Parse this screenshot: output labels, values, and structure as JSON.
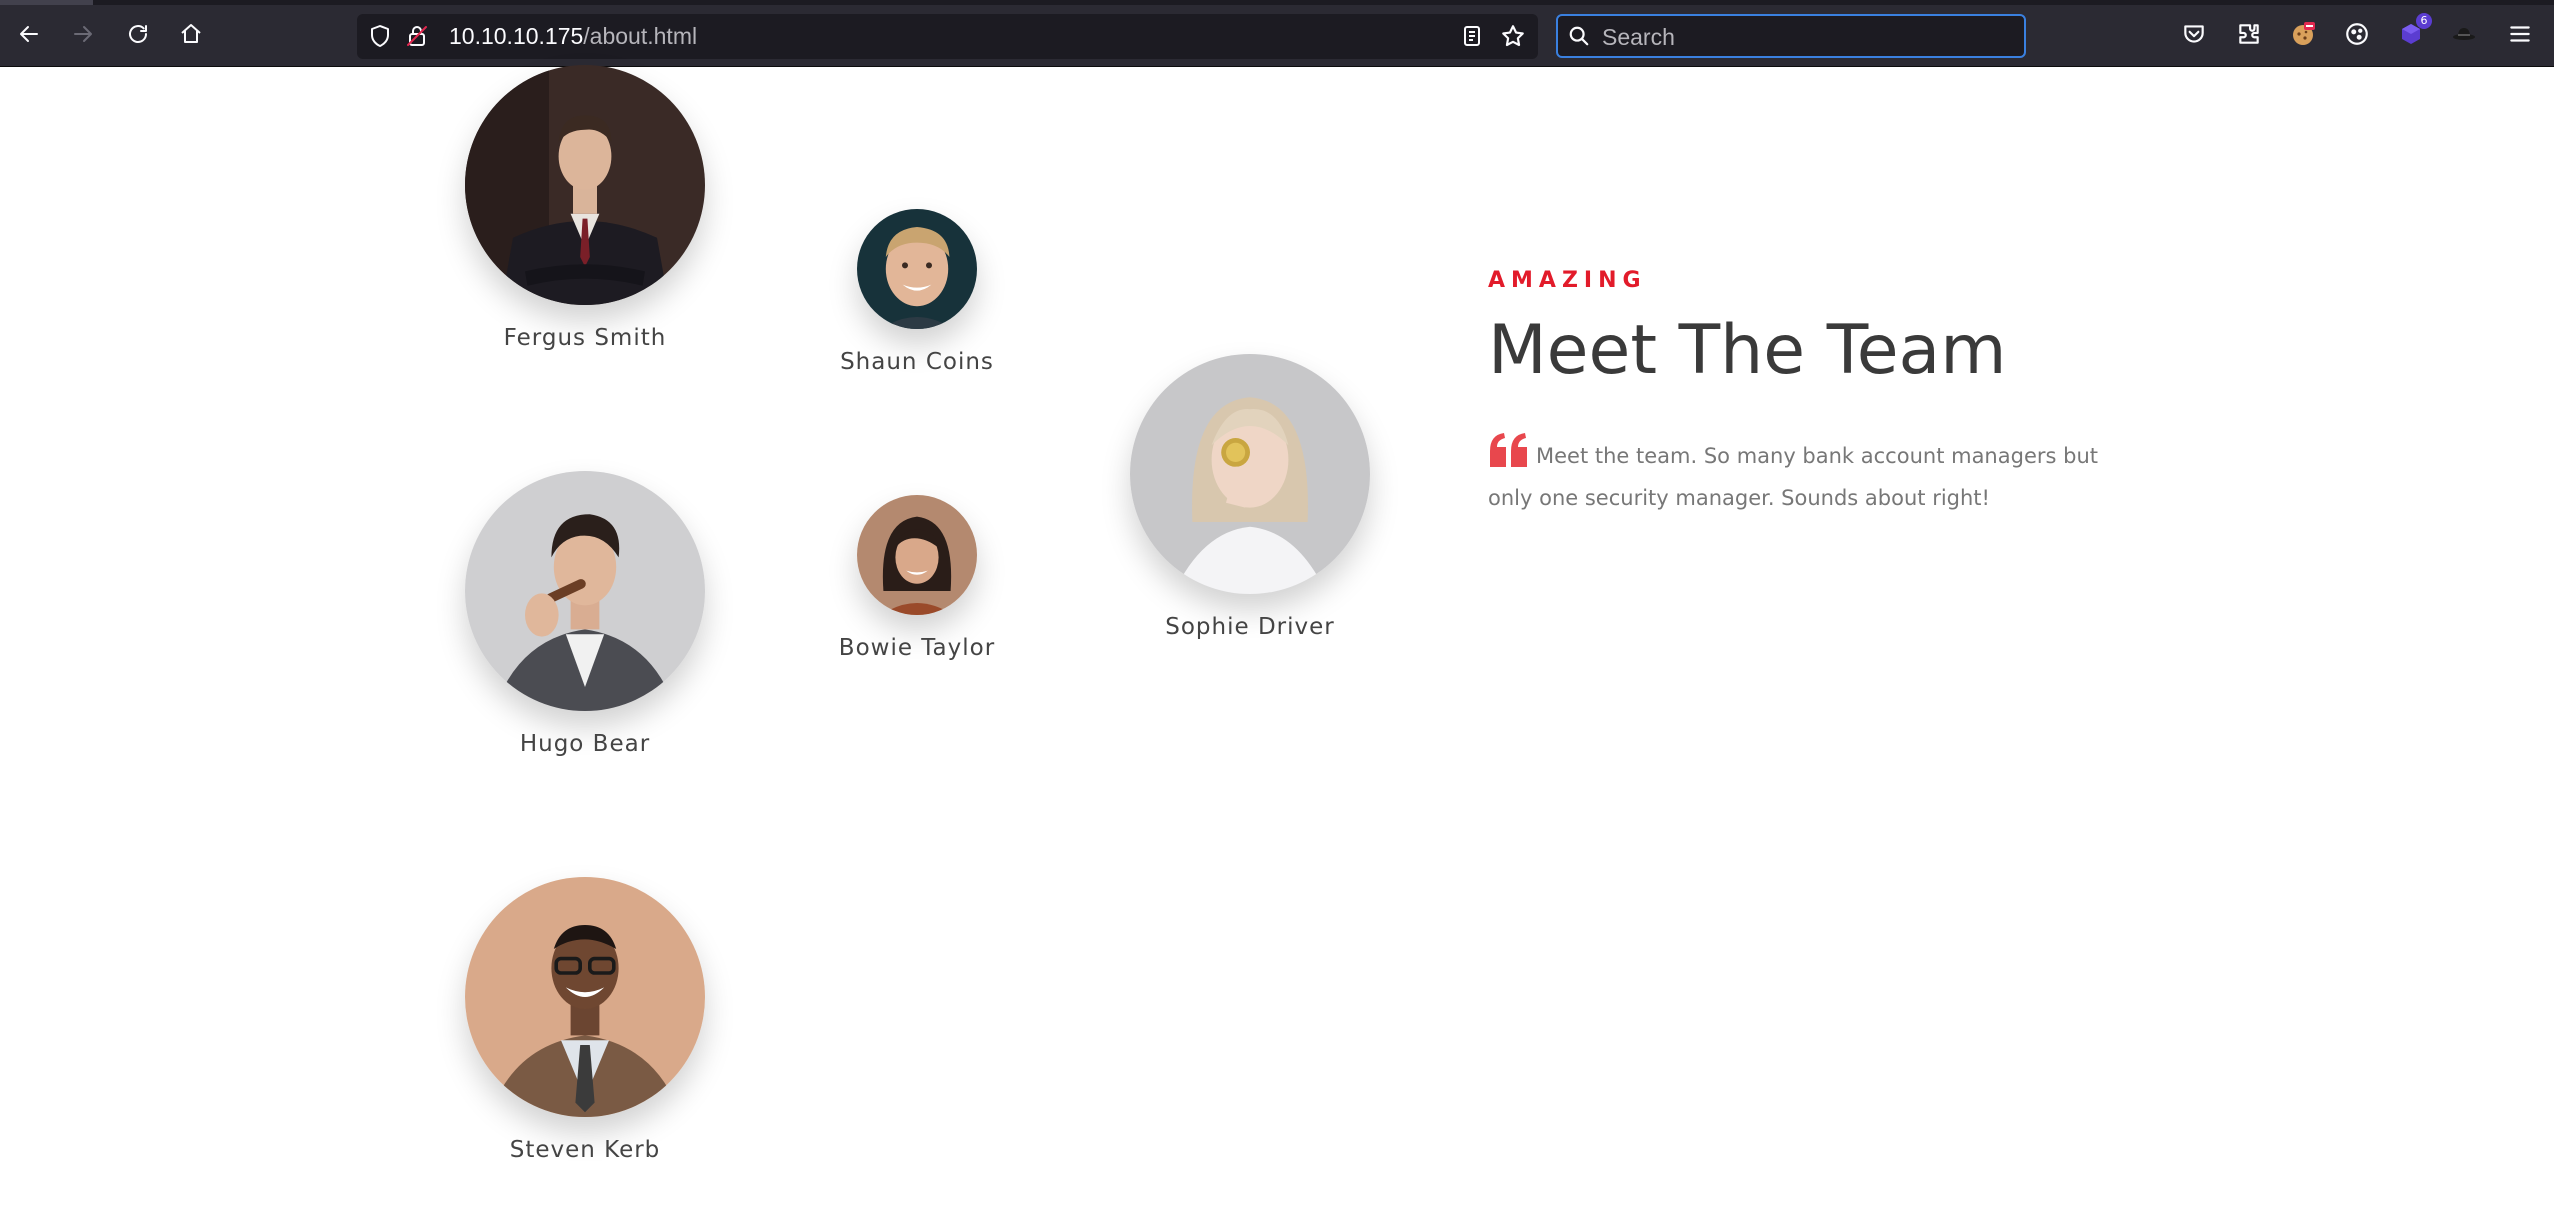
{
  "browser": {
    "url": {
      "host": "10.10.10.175",
      "path": "/about.html"
    },
    "search": {
      "placeholder": "Search",
      "value": ""
    },
    "extension_badge_count": "6"
  },
  "team_section": {
    "eyebrow": "AMAZING",
    "title": "Meet The Team",
    "description": "Meet the team. So many bank account managers but only one security manager. Sounds about right!",
    "accent_color": "#e21b2a",
    "members": [
      {
        "name": "Fergus Smith"
      },
      {
        "name": "Shaun Coins"
      },
      {
        "name": "Sophie Driver"
      },
      {
        "name": "Hugo Bear"
      },
      {
        "name": "Bowie Taylor"
      },
      {
        "name": "Steven Kerb"
      }
    ]
  }
}
